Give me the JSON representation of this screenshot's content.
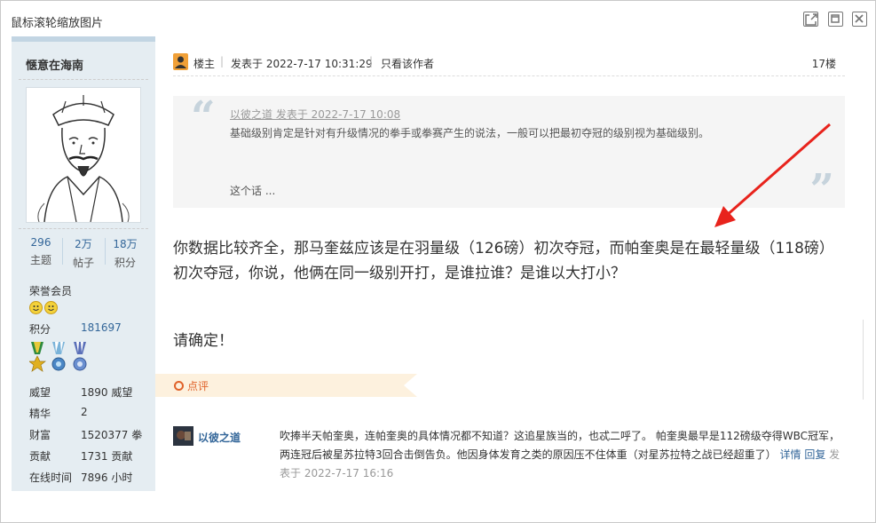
{
  "window": {
    "title": "鼠标滚轮缩放图片"
  },
  "sidebar": {
    "username": "惬意在海南",
    "stats": [
      {
        "num": "296",
        "label": "主题"
      },
      {
        "num": "2万",
        "label": "帖子"
      },
      {
        "num": "18万",
        "label": "积分"
      }
    ],
    "rank": "荣誉会员",
    "points_label": "积分",
    "points_value": "181697",
    "info": [
      {
        "key": "威望",
        "value": "1890 威望"
      },
      {
        "key": "精华",
        "value": "2"
      },
      {
        "key": "财富",
        "value": "1520377 拳"
      },
      {
        "key": "贡献",
        "value": "1731 贡献"
      },
      {
        "key": "在线时间",
        "value": "7896 小时"
      }
    ]
  },
  "post": {
    "role": "楼主",
    "posted_at": "发表于 2022-7-17 10:31:29",
    "only_author": "只看该作者",
    "floor": "17楼",
    "quote": {
      "header": "以彼之道 发表于 2022-7-17 10:08",
      "body": "基础级别肯定是针对有升级情况的拳手或拳赛产生的说法，一般可以把最初夺冠的级别视为基础级别。",
      "more": "这个话 ..."
    },
    "text_line1": "你数据比较齐全，那马奎兹应该是在羽量级（126磅）初次夺冠，而帕奎奥是在最轻量级（118磅）初次夺冠，你说，他俩在同一级别开打，是谁拉谁？是谁以大打小？",
    "text_line2": "请确定！"
  },
  "comments": {
    "tab_label": "点评",
    "items": [
      {
        "user": "以彼之道",
        "text": "吹捧半天帕奎奥，连帕奎奥的具体情况都不知道？这追星族当的，也忒二呼了。 帕奎奥最早是112磅级夺得WBC冠军，两连冠后被星苏拉特3回合击倒告负。他因身体发育之类的原因压不住体重（对星苏拉特之战已经超重了）",
        "detail": "详情",
        "reply": "回复",
        "meta": "发表于 2022-7-17 16:16"
      }
    ]
  },
  "colors": {
    "sidebar_bg": "#e5edf2",
    "link": "#336699",
    "accent": "#e0632b",
    "arrow": "#e8231c"
  },
  "icons": [
    "open-external-icon",
    "maximize-icon",
    "close-icon",
    "host-badge-icon",
    "quote-open-icon",
    "quote-close-icon",
    "comment-ring-icon",
    "smiley-icon",
    "medal-icon"
  ]
}
